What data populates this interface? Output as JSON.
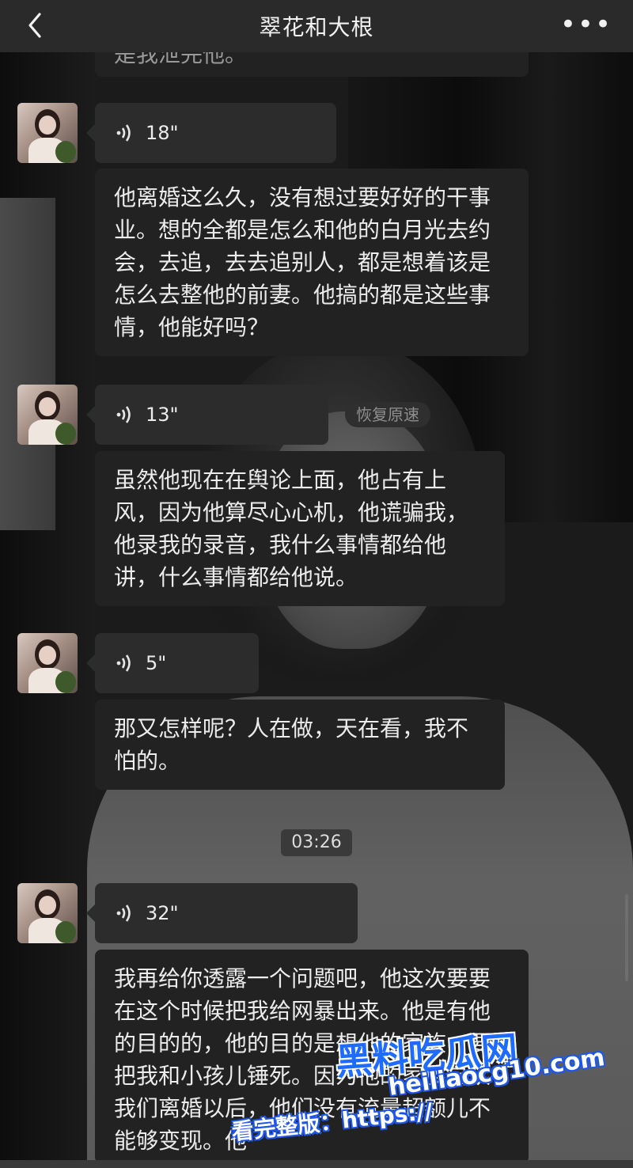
{
  "header": {
    "title": "翠花和大根",
    "more_label": "•••"
  },
  "partial_top_text": "是我泄完他。",
  "messages": [
    {
      "voice": "18\"",
      "transcript": "他离婚这么久，没有想过要好好的干事业。想的全都是怎么和他的白月光去约会，去追，去去追别人，都是想着该是怎么去整他的前妻。他搞的都是这些事情，他能好吗？"
    },
    {
      "voice": "13\"",
      "transcript": "虽然他现在在舆论上面，他占有上风，因为他算尽心心机，他谎骗我，他录我的录音，我什么事情都给他讲，什么事情都给他说。"
    },
    {
      "voice": "5\"",
      "transcript": "那又怎样呢？人在做，天在看，我不怕的。"
    },
    {
      "voice": "32\"",
      "transcript": "我再给你透露一个问题吧，他这次要要在这个时候把我给网暴出来。他是有他的目的的，他的目的是想他的家族，要把我和小孩儿锤死。因为他的家族自从我们离婚以后，他们没有流量超额儿不能够变现。他"
    }
  ],
  "restore_speed_label": "恢复原速",
  "timestamp": "03:26",
  "watermark": {
    "brand": "黑料吃瓜网",
    "url": "heiliaocg10.com",
    "cta": "看完整版：https://"
  },
  "icons": {
    "back": "chevron-left-icon",
    "voice": "voice-wave-icon",
    "more": "more-dots-icon"
  }
}
